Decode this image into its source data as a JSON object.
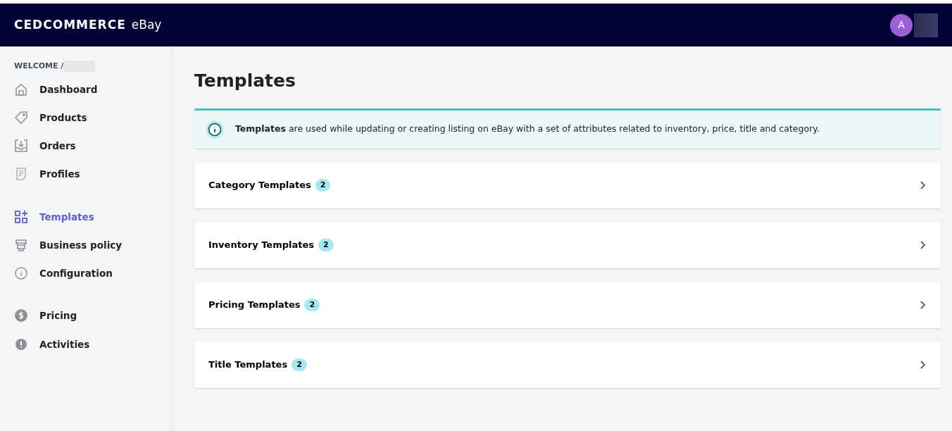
{
  "header": {
    "logo": "CEDCOMMERCE",
    "logo_suffix": "eBay",
    "avatar": "A"
  },
  "sidebar": {
    "welcome": "WELCOME /",
    "groups": [
      [
        {
          "label": "Dashboard",
          "selected": false
        },
        {
          "label": "Products",
          "selected": false
        },
        {
          "label": "Orders",
          "selected": false
        },
        {
          "label": "Profiles",
          "selected": false
        }
      ],
      [
        {
          "label": "Templates",
          "selected": true
        },
        {
          "label": "Business policy",
          "selected": false
        },
        {
          "label": "Configuration",
          "selected": false
        }
      ],
      [
        {
          "label": "Pricing",
          "selected": false
        },
        {
          "label": "Activities",
          "selected": false
        }
      ]
    ]
  },
  "page": {
    "title": "Templates",
    "notice": "**Templates** are used while updating or creating listing on eBay with a set of attributes related to inventory, price, title and category.",
    "sections": [
      {
        "label": "Category Templates",
        "count": "2"
      },
      {
        "label": "Inventory Templates",
        "count": "2"
      },
      {
        "label": "Pricing Templates",
        "count": "2"
      },
      {
        "label": "Title Templates",
        "count": "2"
      }
    ]
  }
}
